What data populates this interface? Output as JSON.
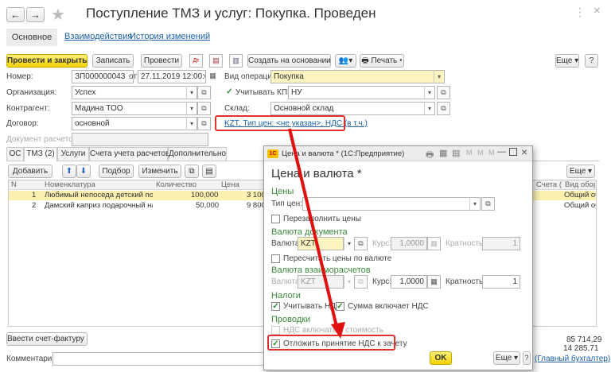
{
  "window": {
    "title": "Поступление ТМЗ и услуг: Покупка. Проведен"
  },
  "nav": {
    "back": "←",
    "forward": "→",
    "star": "★",
    "more": "⋮",
    "close": "×"
  },
  "tabs": [
    "Основное",
    "Взаимодействия",
    "История изменений"
  ],
  "toolbar": {
    "post_close": "Провести и закрыть",
    "save": "Записать",
    "post": "Провести",
    "create_based": "Создать на основании",
    "print": "Печать",
    "more": "Еще",
    "help": "?"
  },
  "form": {
    "number_label": "Номер:",
    "number_value": "ЗП000000043",
    "from_label": "от:",
    "date_value": "27.11.2019 12:00:00",
    "op_label": "Вид операции:",
    "op_value": "Покупка",
    "org_label": "Организация:",
    "org_value": "Успех",
    "kpn_label": "Учитывать КПН",
    "kpn_value": "НУ",
    "contr_label": "Контрагент:",
    "contr_value": "Мадина ТОО",
    "warehouse_label": "Склад:",
    "warehouse_value": "Основной склад",
    "contract_label": "Договор:",
    "contract_value": "основной",
    "price_link": "KZT, Тип цен: <не указан>, НДС (в т.ч.)",
    "settle_doc_label": "Документ расчетов:"
  },
  "doc_tabs": [
    "ОС",
    "ТМЗ (2)",
    "Услуги",
    "Счета учета расчетов",
    "Дополнительно"
  ],
  "table_toolbar": {
    "add": "Добавить",
    "pick": "Подбор",
    "edit": "Изменить",
    "more": "Еще"
  },
  "table": {
    "columns": [
      "N",
      "Номенклатура",
      "Количество",
      "Цена"
    ],
    "right_columns": [
      "Счета (",
      "Вид обор"
    ],
    "rows": [
      {
        "n": "1",
        "name": "Любимый непоседа детский пода...",
        "qty": "100,000",
        "price": "3 100,",
        "right": "Общий об"
      },
      {
        "n": "2",
        "name": "Дамский каприз подарочный наб",
        "qty": "50,000",
        "price": "9 800,",
        "right": "Общий об"
      }
    ]
  },
  "footer": {
    "invoice_btn": "Ввести счет-фактуру",
    "total": "85 714,29",
    "ndc_total": "14 285,71",
    "comment_label": "Комментарий:",
    "accountant_link": "(Главный бухгалтер)"
  },
  "dialog": {
    "title": "Цена и валюта * (1С:Предприятие)",
    "heading": "Цена и валюта *",
    "section_prices": "Цены",
    "price_type_label": "Тип цен:",
    "refill_prices": "Перезаполнить цены",
    "section_doc_currency": "Валюта документа",
    "currency_label": "Валюта:",
    "currency_value": "KZT",
    "rate_label": "Курс:",
    "rate_value": "1,0000",
    "mult_label": "Кратность:",
    "mult_value": "1",
    "recalc": "Пересчитать цены по валюте",
    "section_settle": "Валюта взаиморасчетов",
    "settle_currency_value": "KZT",
    "settle_rate_value": "1,0000",
    "settle_mult_value": "1",
    "section_taxes": "Налоги",
    "consider_vat": "Учитывать НДС",
    "sum_incl_vat": "Сумма включает НДС",
    "section_postings": "Проводки",
    "vat_in_cost": "НДС включать в стоимость",
    "defer_vat": "Отложить принятие НДС к зачету",
    "ok": "OK",
    "more": "Еще",
    "help": "?"
  },
  "colors": {
    "accent": "#f3d200",
    "link": "#1c5fa8",
    "section": "#3a8a3a",
    "arrow": "#e01010",
    "highlight": "#e03030"
  }
}
